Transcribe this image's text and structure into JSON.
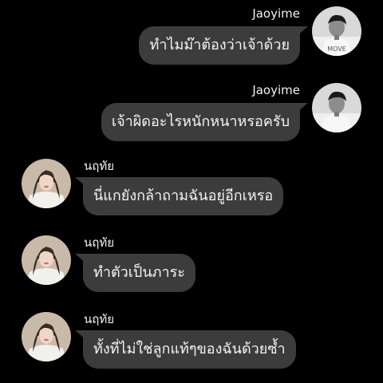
{
  "messages": [
    {
      "side": "out",
      "sender": "Jaoyime",
      "text": "ทำไมม๊าต้องว่าเจ้าด้วย",
      "avatar_icon": "male-avatar-bw-icon"
    },
    {
      "side": "out",
      "sender": "Jaoyime",
      "text": "เจ้าผิดอะไรหนักหนาหรอครับ",
      "avatar_icon": "male-avatar-bw-icon"
    },
    {
      "side": "in",
      "sender": "นฤทัย",
      "text": "นี่แกยังกล้าถามฉันอยู่อีกเหรอ",
      "avatar_icon": "female-avatar-icon"
    },
    {
      "side": "in",
      "sender": "นฤทัย",
      "text": "ทำตัวเป็นภาระ",
      "avatar_icon": "female-avatar-icon"
    },
    {
      "side": "in",
      "sender": "นฤทัย",
      "text": "ทั้งที่ไม่ใช่ลูกแท้ๆของฉันด้วยซ้ำ",
      "avatar_icon": "female-avatar-icon"
    }
  ],
  "colors": {
    "background": "#000000",
    "bubble": "#3c3c3c",
    "text": "#f4f4f4"
  }
}
